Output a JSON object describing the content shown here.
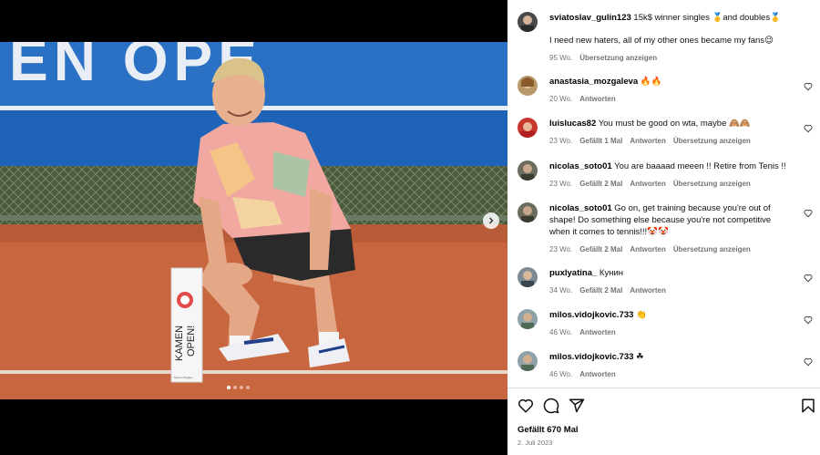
{
  "media": {
    "banner_text": "EN OPE",
    "trophy_lines": [
      "KAMEN",
      "OPEN!"
    ],
    "trophy_small": "Kamen Singles",
    "dots_total": 4,
    "dots_active": 0
  },
  "caption": {
    "username": "sviatoslav_gulin123",
    "text": " 15k$ winner singles 🥇and doubles🥇",
    "text2": "I need new haters, all of my other ones became my fans😉",
    "time": "95 Wo.",
    "translate": "Übersetzung anzeigen"
  },
  "comments": [
    {
      "username": "anastasia_mozgaleva",
      "text": " 🔥🔥",
      "time": "20 Wo.",
      "likes": "",
      "reply": "Antworten",
      "translate": ""
    },
    {
      "username": "luislucas82",
      "text": " You must be good on wta, maybe 🙈🙈",
      "time": "23 Wo.",
      "likes": "Gefällt 1 Mal",
      "reply": "Antworten",
      "translate": "Übersetzung anzeigen"
    },
    {
      "username": "nicolas_soto01",
      "text": " You are baaaad meeen !! Retire from Tenis !!",
      "time": "23 Wo.",
      "likes": "Gefällt 2 Mal",
      "reply": "Antworten",
      "translate": "Übersetzung anzeigen"
    },
    {
      "username": "nicolas_soto01",
      "text": " Go on, get training because you're out of shape! Do something else because you're not competitive when it comes to tennis!!!🤡🤡",
      "time": "23 Wo.",
      "likes": "Gefällt 2 Mal",
      "reply": "Antworten",
      "translate": "Übersetzung anzeigen"
    },
    {
      "username": "puxlyatina_",
      "text": " Кунин",
      "time": "34 Wo.",
      "likes": "Gefällt 2 Mal",
      "reply": "Antworten",
      "translate": ""
    },
    {
      "username": "milos.vidojkovic.733",
      "text": " 👏",
      "time": "46 Wo.",
      "likes": "",
      "reply": "Antworten",
      "translate": ""
    },
    {
      "username": "milos.vidojkovic.733",
      "text": " ☘",
      "time": "46 Wo.",
      "likes": "",
      "reply": "Antworten",
      "translate": ""
    }
  ],
  "actions": {
    "likes": "Gefällt 670 Mal",
    "date": "2. Juli 2023"
  },
  "colors": {
    "banner": "#1e63b8",
    "clay": "#c8673f",
    "meta": "#737373"
  }
}
